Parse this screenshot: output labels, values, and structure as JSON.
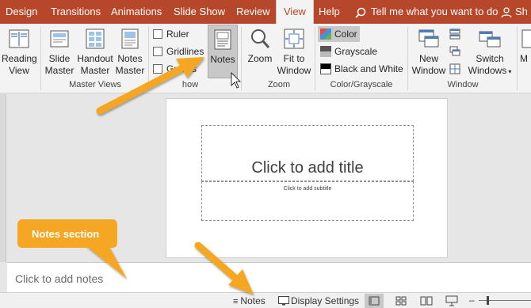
{
  "tabs": {
    "design": "Design",
    "transitions": "Transitions",
    "animations": "Animations",
    "slideshow": "Slide Show",
    "review": "Review",
    "view": "View",
    "help": "Help",
    "share": "Sh"
  },
  "tell_me": "Tell me what you want to do",
  "ribbon": {
    "reading_view": [
      "Reading",
      "View"
    ],
    "slide_master": [
      "Slide",
      "Master"
    ],
    "handout_master": [
      "Handout",
      "Master"
    ],
    "notes_master": [
      "Notes",
      "Master"
    ],
    "master_views_label": "Master Views",
    "ruler": "Ruler",
    "gridlines": "Gridlines",
    "guides": "Guides",
    "show_label_partial": "how",
    "notes": "Notes",
    "zoom": "Zoom",
    "fit_to_window": [
      "Fit to",
      "Window"
    ],
    "zoom_label": "Zoom",
    "color": "Color",
    "grayscale": "Grayscale",
    "black_and_white": "Black and White",
    "color_grayscale_label": "Color/Grayscale",
    "new_window": [
      "New",
      "Window"
    ],
    "switch_windows": [
      "Switch",
      "Windows"
    ],
    "window_label": "Window",
    "macros_partial": "M"
  },
  "slide": {
    "title_placeholder": "Click to add title",
    "subtitle_placeholder": "Click to add subtitle"
  },
  "notes_pane": {
    "placeholder": "Click to add notes"
  },
  "callout": {
    "text": "Notes section"
  },
  "status_bar": {
    "notes": "Notes",
    "display_settings": "Display Settings"
  },
  "colors": {
    "tab_bar": "#b7472a",
    "ribbon": "#f3f3f3",
    "callout": "#f5a623",
    "selected_button": "#c8c8c8"
  }
}
